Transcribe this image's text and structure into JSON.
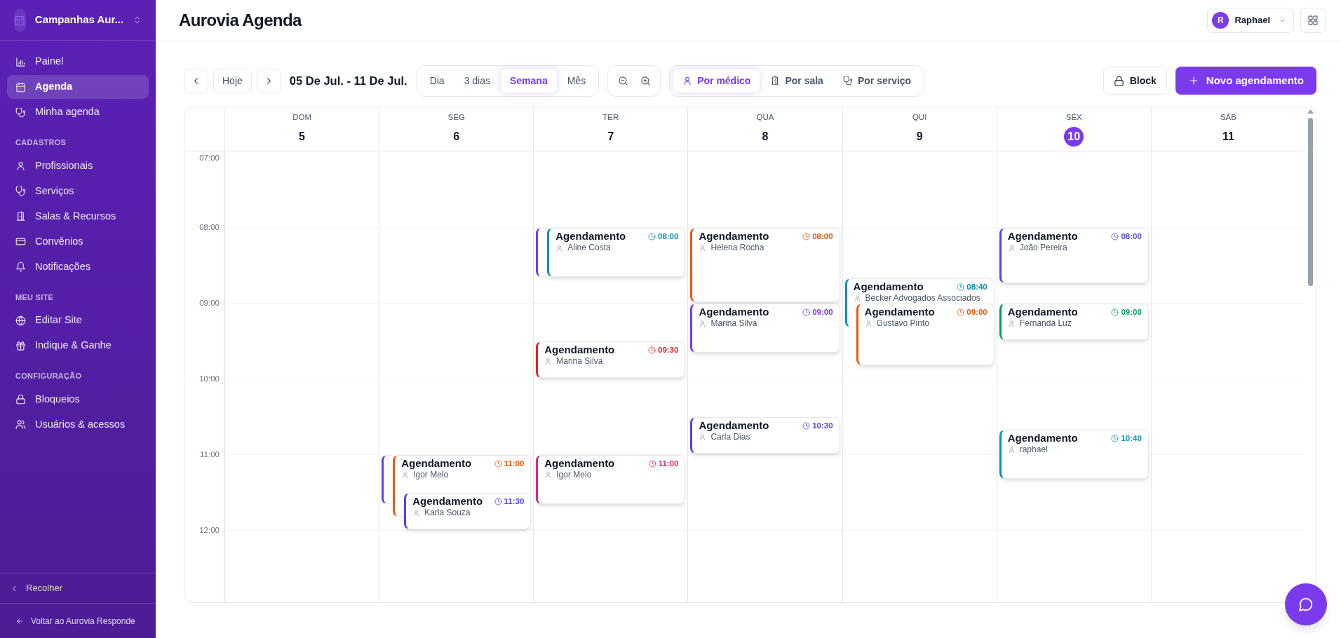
{
  "sidebar": {
    "brand": "Campanhas Aur...",
    "sections": [
      {
        "items": [
          {
            "label": "Painel",
            "selected": false
          },
          {
            "label": "Agenda",
            "selected": true
          },
          {
            "label": "Minha agenda",
            "selected": false
          }
        ]
      },
      {
        "title": "CADASTROS",
        "items": [
          {
            "label": "Profissionais",
            "selected": false
          },
          {
            "label": "Serviços",
            "selected": false
          },
          {
            "label": "Salas & Recursos",
            "selected": false
          },
          {
            "label": "Convênios",
            "selected": false
          },
          {
            "label": "Notificações",
            "selected": false
          }
        ]
      },
      {
        "title": "MEU SITE",
        "items": [
          {
            "label": "Editar Site",
            "selected": false
          },
          {
            "label": "Indique & Ganhe",
            "selected": false
          }
        ]
      },
      {
        "title": "CONFIGURAÇÃO",
        "items": [
          {
            "label": "Bloqueios",
            "selected": false
          },
          {
            "label": "Usuários & acessos",
            "selected": false
          }
        ]
      }
    ],
    "collapse": "Recolher",
    "back_link": "Voltar ao Aurovia Responde"
  },
  "header": {
    "title": "Aurovia Agenda",
    "user": {
      "initial": "R",
      "name": "Raphael"
    }
  },
  "toolbar": {
    "today": "Hoje",
    "range": "05 De Jul. - 11 De Jul.",
    "views": [
      {
        "label": "Dia",
        "selected": false
      },
      {
        "label": "3 dias",
        "selected": false
      },
      {
        "label": "Semana",
        "selected": true
      },
      {
        "label": "Mês",
        "selected": false
      }
    ],
    "group_by": [
      {
        "label": "Por médico",
        "selected": true
      },
      {
        "label": "Por sala",
        "selected": false
      },
      {
        "label": "Por serviço",
        "selected": false
      }
    ],
    "block": "Block",
    "new": "Novo agendamento"
  },
  "calendar": {
    "days": [
      {
        "weekday": "DOM",
        "date": "5",
        "today": false
      },
      {
        "weekday": "SEG",
        "date": "6",
        "today": false,
        "events": [
          {
            "color": "#4f46e5"
          },
          {
            "color": "#ea580c",
            "title": "Agendamento",
            "time": "11:00",
            "person": "Igor Melo"
          },
          {
            "color": "#4f46e5",
            "title": "Agendamento",
            "time": "11:30",
            "person": "Karla Souza"
          }
        ]
      },
      {
        "weekday": "TER",
        "date": "7",
        "today": false,
        "events": [
          {
            "color": "#7c3aed"
          },
          {
            "color": "#0891b2",
            "title": "Agendamento",
            "time": "08:00",
            "person": "Aline Costa"
          },
          {
            "color": "#dc2626",
            "title": "Agendamento",
            "time": "09:30",
            "person": "Marina Silva"
          },
          {
            "color": "#db2777",
            "title": "Agendamento",
            "time": "11:00",
            "person": "Igor Melo"
          }
        ]
      },
      {
        "weekday": "QUA",
        "date": "8",
        "today": false,
        "events": [
          {
            "color": "#ea580c",
            "title": "Agendamento",
            "time": "08:00",
            "person": "Helena Rocha"
          },
          {
            "color": "#7c3aed",
            "title": "Agendamento",
            "time": "09:00",
            "person": "Marina Silva"
          },
          {
            "color": "#4f46e5",
            "title": "Agendamento",
            "time": "10:30",
            "person": "Carla Dias"
          }
        ]
      },
      {
        "weekday": "QUI",
        "date": "9",
        "today": false,
        "events": [
          {
            "color": "#0891b2",
            "title": "Agendamento",
            "time": "08:40",
            "person": "Becker Advogados Associados"
          },
          {
            "color": "#ea580c",
            "title": "Agendamento",
            "time": "09:00",
            "person": "Gustavo Pinto"
          }
        ]
      },
      {
        "weekday": "SEX",
        "date": "10",
        "today": true,
        "events": [
          {
            "color": "#4f46e5",
            "title": "Agendamento",
            "time": "08:00",
            "person": "João Pereira"
          },
          {
            "color": "#059669",
            "title": "Agendamento",
            "time": "09:00",
            "person": "Fernanda Luz"
          },
          {
            "color": "#0891b2",
            "title": "Agendamento",
            "time": "10:40",
            "person": "raphael"
          }
        ]
      },
      {
        "weekday": "SÁB",
        "date": "11",
        "today": false
      }
    ],
    "hours": [
      "07:00",
      "08:00",
      "09:00",
      "10:00",
      "11:00",
      "12:00"
    ]
  }
}
